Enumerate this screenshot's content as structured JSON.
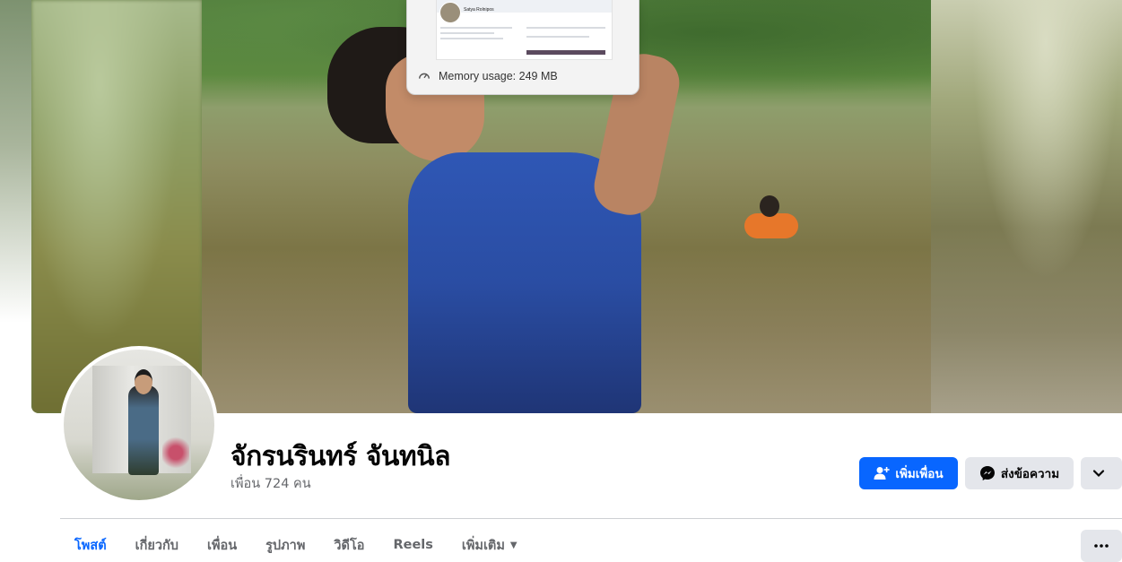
{
  "memory_tooltip": {
    "text": "Memory usage: 249 MB",
    "thumbnail_name": "Satya Rolnipos"
  },
  "profile": {
    "name": "จักรนรินทร์ จันทนิล",
    "friends_text": "เพื่อน 724 คน"
  },
  "actions": {
    "add_friend": "เพิ่มเพื่อน",
    "message": "ส่งข้อความ"
  },
  "tabs": [
    {
      "label": "โพสต์",
      "active": true
    },
    {
      "label": "เกี่ยวกับ",
      "active": false
    },
    {
      "label": "เพื่อน",
      "active": false
    },
    {
      "label": "รูปภาพ",
      "active": false
    },
    {
      "label": "วิดีโอ",
      "active": false
    },
    {
      "label": "Reels",
      "active": false
    },
    {
      "label": "เพิ่มเติม",
      "active": false
    }
  ],
  "colors": {
    "primary": "#0866ff",
    "secondary_button": "#e4e6eb",
    "muted_text": "#65676b"
  },
  "icons": {
    "add_friend": "person-plus-icon",
    "message": "messenger-icon",
    "more": "chevron-down-icon",
    "tab_more": "ellipsis-icon",
    "memory": "gauge-icon"
  }
}
